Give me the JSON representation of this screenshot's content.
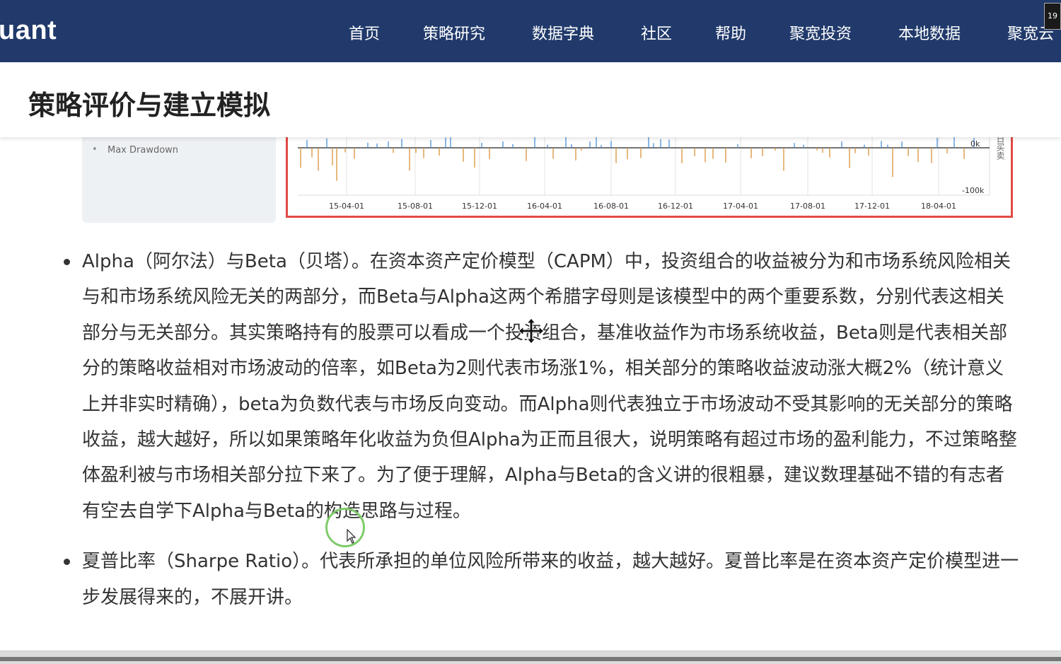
{
  "nav": {
    "logo": "uant",
    "items": [
      "首页",
      "策略研究",
      "数据字典",
      "社区",
      "帮助",
      "聚宽投资",
      "本地数据",
      "聚宽云"
    ],
    "badge": "19"
  },
  "page": {
    "title": "策略评价与建立模拟"
  },
  "side_panel": {
    "item": "Max Drawdown"
  },
  "chart": {
    "x_ticks": [
      "15-04-01",
      "15-08-01",
      "15-12-01",
      "16-04-01",
      "16-08-01",
      "16-12-01",
      "17-04-01",
      "17-08-01",
      "17-12-01",
      "18-04-01"
    ],
    "y_ticks": [
      "0k",
      "-100k"
    ],
    "side_label": "日买卖"
  },
  "content": {
    "bullets": [
      "Alpha（阿尔法）与Beta（贝塔）。在资本资产定价模型（CAPM）中，投资组合的收益被分为和市场系统风险相关与和市场系统风险无关的两部分，而Beta与Alpha这两个希腊字母则是该模型中的两个重要系数，分别代表这相关部分与无关部分。其实策略持有的股票可以看成一个投资组合，基准收益作为市场系统收益，Beta则是代表相关部分的策略收益相对市场波动的倍率，如Beta为2则代表市场涨1%，相关部分的策略收益波动涨大概2%（统计意义上并非实时精确），beta为负数代表与市场反向变动。而Alpha则代表独立于市场波动不受其影响的无关部分的策略收益，越大越好，所以如果策略年化收益为负但Alpha为正而且很大，说明策略有超过市场的盈利能力，不过策略整体盈利被与市场相关部分拉下来了。为了便于理解，Alpha与Beta的含义讲的很粗暴，建议数理基础不错的有志者有空去自学下Alpha与Beta的构造思路与过程。",
      "夏普比率（Sharpe Ratio）。代表所承担的单位风险所带来的收益，越大越好。夏普比率是在资本资产定价模型进一步发展得来的，不展开讲。"
    ]
  }
}
